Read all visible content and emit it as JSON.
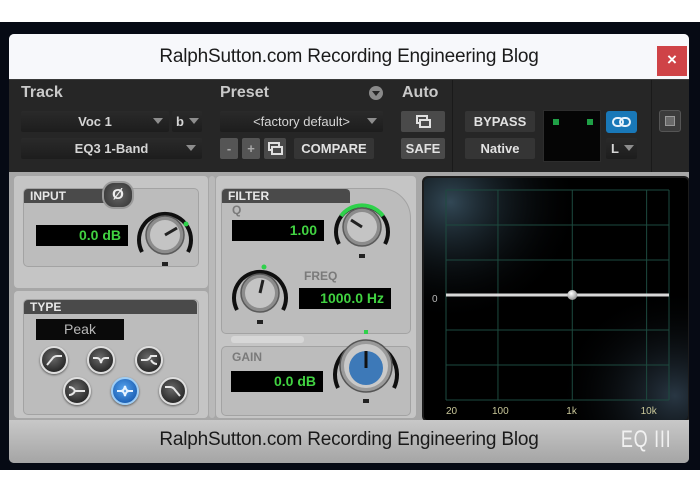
{
  "window": {
    "title": "RalphSutton.com Recording Engineering Blog",
    "close_label": "×",
    "footer_text": "RalphSutton.com Recording Engineering Blog",
    "logo": "EQ III"
  },
  "header": {
    "track_label": "Track",
    "preset_label": "Preset",
    "auto_label": "Auto",
    "track_name": "Voc 1",
    "track_variant": "b",
    "plugin_name": "EQ3 1-Band",
    "preset_name": "<factory default>",
    "minus_label": "-",
    "plus_label": "+",
    "compare_label": "COMPARE",
    "safe_label": "SAFE",
    "bypass_label": "BYPASS",
    "native_label": "Native",
    "channel_label": "L"
  },
  "input": {
    "tab": "INPUT",
    "phase_symbol": "Ø",
    "value": "0.0 dB"
  },
  "type": {
    "tab": "TYPE",
    "selected": "Peak",
    "buttons": [
      "high-pass",
      "notch",
      "low-shelf",
      "high-shelf",
      "peak",
      "low-pass"
    ]
  },
  "filter": {
    "tab": "FILTER",
    "q_label": "Q",
    "q_value": "1.00",
    "freq_label": "FREQ",
    "freq_value": "1000.0 Hz",
    "gain_label": "GAIN",
    "gain_value": "0.0 dB"
  },
  "graph": {
    "y_zero_label": "0",
    "x_labels": [
      "20",
      "100",
      "1k",
      "10k"
    ],
    "node_freq_hz": 1000,
    "node_gain_db": 0
  },
  "colors": {
    "lcd_text": "#41d241",
    "link_blue": "#1978b8",
    "close_red": "#cf4347",
    "grid": "#1d4a3f"
  }
}
